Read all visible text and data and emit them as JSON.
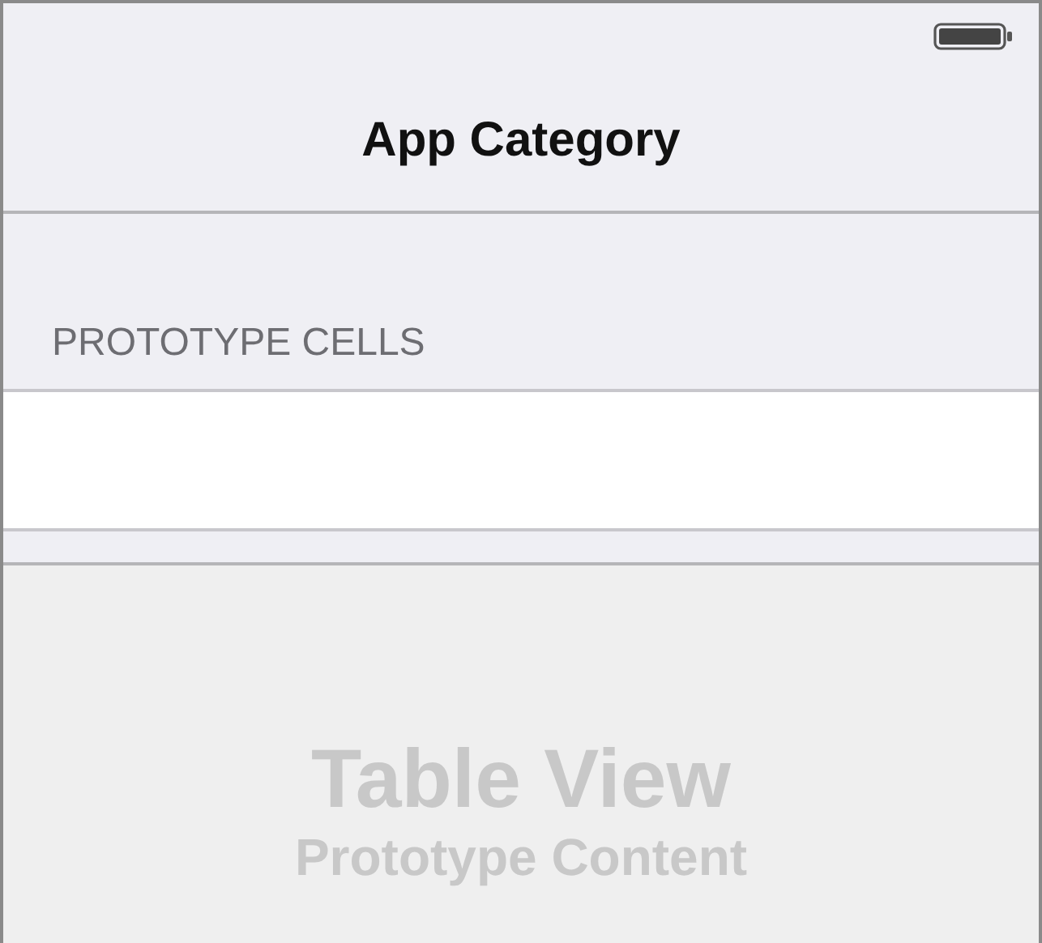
{
  "navigation_bar": {
    "title": "App Category"
  },
  "section": {
    "header": "PROTOTYPE CELLS",
    "cells": [
      {
        "kind": "blank"
      }
    ]
  },
  "placeholder": {
    "title": "Table View",
    "subtitle": "Prototype Content"
  }
}
